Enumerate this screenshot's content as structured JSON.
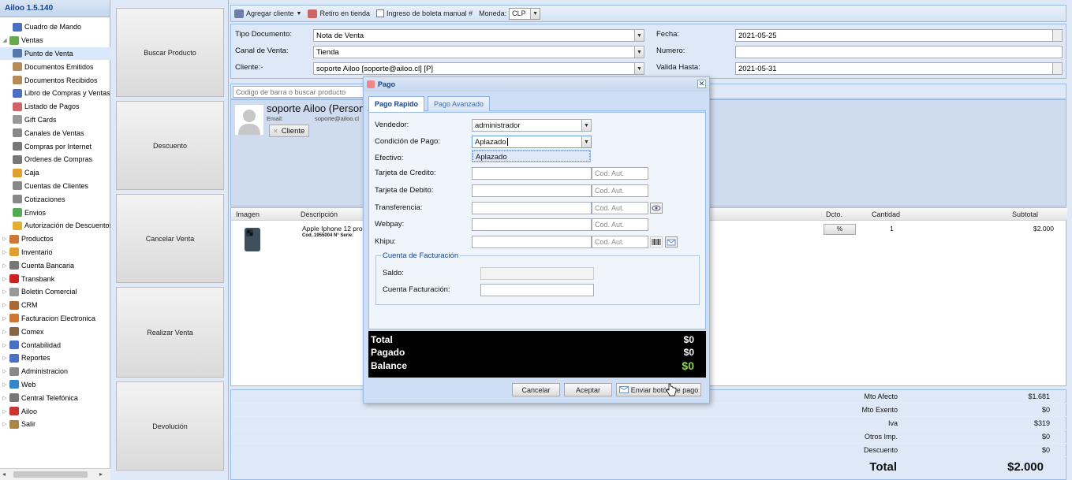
{
  "nav": {
    "header": "Ailoo 1.5.140",
    "items": [
      {
        "label": "Cuadro de Mando",
        "level": 1,
        "icon": "chart-icon",
        "color": "#4a6fc4"
      },
      {
        "label": "Ventas",
        "level": 0,
        "expanded": true,
        "icon": "gem-icon",
        "color": "#6aa84f"
      },
      {
        "label": "Punto de Venta",
        "level": 1,
        "selected": true,
        "icon": "register-icon",
        "color": "#5577aa"
      },
      {
        "label": "Documentos Emitidos",
        "level": 1,
        "icon": "document-icon",
        "color": "#b58b5a"
      },
      {
        "label": "Documentos Recibidos",
        "level": 1,
        "icon": "document-icon",
        "color": "#b58b5a"
      },
      {
        "label": "Libro de Compras y Ventas",
        "level": 1,
        "icon": "book-icon",
        "color": "#4a6fc4"
      },
      {
        "label": "Listado de Pagos",
        "level": 1,
        "icon": "list-icon",
        "color": "#cc6666"
      },
      {
        "label": "Gift Cards",
        "level": 1,
        "icon": "card-icon",
        "color": "#999999"
      },
      {
        "label": "Canales de Ventas",
        "level": 1,
        "icon": "channel-icon",
        "color": "#888888"
      },
      {
        "label": "Compras por Internet",
        "level": 1,
        "icon": "cart-icon",
        "color": "#777777"
      },
      {
        "label": "Ordenes de Compras",
        "level": 1,
        "icon": "cart-icon",
        "color": "#777777"
      },
      {
        "label": "Caja",
        "level": 1,
        "icon": "cashbox-icon",
        "color": "#e0a030"
      },
      {
        "label": "Cuentas de Clientes",
        "level": 1,
        "icon": "accounts-icon",
        "color": "#888888"
      },
      {
        "label": "Cotizaciones",
        "level": 1,
        "icon": "quote-icon",
        "color": "#888888"
      },
      {
        "label": "Envios",
        "level": 1,
        "icon": "truck-icon",
        "color": "#55aa55"
      },
      {
        "label": "Autorización de Descuentos",
        "level": 1,
        "icon": "key-icon",
        "color": "#e0b030"
      },
      {
        "label": "Productos",
        "level": 0,
        "icon": "box-icon",
        "color": "#cc7733"
      },
      {
        "label": "Inventario",
        "level": 0,
        "icon": "cube-icon",
        "color": "#e0a030"
      },
      {
        "label": "Cuenta Bancaria",
        "level": 0,
        "icon": "bank-icon",
        "color": "#777777"
      },
      {
        "label": "Transbank",
        "level": 0,
        "icon": "transbank-icon",
        "color": "#cc2222"
      },
      {
        "label": "Boletin Comercial",
        "level": 0,
        "icon": "tag-icon",
        "color": "#999999"
      },
      {
        "label": "CRM",
        "level": 0,
        "icon": "users-icon",
        "color": "#aa6633"
      },
      {
        "label": "Facturacion Electronica",
        "level": 0,
        "icon": "invoice-icon",
        "color": "#cc7733"
      },
      {
        "label": "Comex",
        "level": 0,
        "icon": "ship-icon",
        "color": "#886644"
      },
      {
        "label": "Contabilidad",
        "level": 0,
        "icon": "ledger-icon",
        "color": "#4a6fc4"
      },
      {
        "label": "Reportes",
        "level": 0,
        "icon": "chart-icon",
        "color": "#4a6fc4"
      },
      {
        "label": "Administracion",
        "level": 0,
        "icon": "gear-icon",
        "color": "#888888"
      },
      {
        "label": "Web",
        "level": 0,
        "icon": "globe-icon",
        "color": "#3388cc"
      },
      {
        "label": "Central Telefónica",
        "level": 0,
        "icon": "phone-icon",
        "color": "#777777"
      },
      {
        "label": "Ailoo",
        "level": 0,
        "icon": "ailoo-icon",
        "color": "#cc3333"
      },
      {
        "label": "Salir",
        "level": 0,
        "icon": "exit-icon",
        "color": "#aa8844"
      }
    ]
  },
  "actions": {
    "buscar": "Buscar Producto",
    "descuento": "Descuento",
    "cancelar": "Cancelar Venta",
    "realizar": "Realizar Venta",
    "devolucion": "Devolución"
  },
  "toolbar": {
    "agregar_cliente": "Agregar cliente",
    "retiro": "Retiro en tienda",
    "boleta_manual": "Ingreso de boleta manual #",
    "moneda_label": "Moneda:",
    "moneda_value": "CLP"
  },
  "docform": {
    "tipo_label": "Tipo Documento:",
    "tipo_value": "Nota de Venta",
    "canal_label": "Canal de Venta:",
    "canal_value": "Tienda",
    "cliente_label": "Cliente:-",
    "cliente_value": "soporte Ailoo [soporte@ailoo.cl] [P]",
    "fecha_label": "Fecha:",
    "fecha_value": "2021-05-25",
    "numero_label": "Numero:",
    "numero_value": "",
    "valida_label": "Valida Hasta:",
    "valida_value": "2021-05-31"
  },
  "search": {
    "placeholder": "Codigo de barra o buscar producto"
  },
  "customer": {
    "name": "soporte Ailoo (Person",
    "email_label": "Email:",
    "email_value": "soporte@ailoo.cl",
    "cliente_button": "Cliente"
  },
  "grid": {
    "headers": {
      "imagen": "Imagen",
      "descripcion": "Descripción",
      "dcto": "Dcto.",
      "cantidad": "Cantidad",
      "subtotal": "Subtotal"
    },
    "rows": [
      {
        "descripcion": "Apple Iphone 12 pro",
        "codigo": "Cod. 1955004 N° Serie:",
        "dcto": "%",
        "cantidad": "1",
        "subtotal": "$2.000"
      }
    ]
  },
  "totals": {
    "mto_afecto_label": "Mto Afecto",
    "mto_afecto": "$1.681",
    "mto_exento_label": "Mto Exento",
    "mto_exento": "$0",
    "iva_label": "Iva",
    "iva": "$319",
    "otros_label": "Otros Imp.",
    "otros": "$0",
    "descuento_label": "Descuento",
    "descuento": "$0",
    "total_label": "Total",
    "total": "$2.000"
  },
  "dialog": {
    "title": "Pago",
    "tabs": [
      "Pago Rapido",
      "Pago Avanzado"
    ],
    "vendedor_label": "Vendedor:",
    "vendedor_value": "administrador",
    "condicion_label": "Condición de Pago:",
    "condicion_value": "Aplazado",
    "dropdown_option": "Aplazado",
    "efectivo_label": "Efectivo:",
    "tarjeta_credito_label": "Tarjeta de Credito:",
    "tarjeta_debito_label": "Tarjeta de Debito:",
    "transferencia_label": "Transferencia:",
    "webpay_label": "Webpay:",
    "khipu_label": "Khipu:",
    "cod_aut_placeholder": "Cod. Aut.",
    "facturacion_legend": "Cuenta de Facturación",
    "saldo_label": "Saldo:",
    "cuenta_fact_label": "Cuenta Facturación:",
    "summary": {
      "total_label": "Total",
      "total": "$0",
      "pagado_label": "Pagado",
      "pagado": "$0",
      "balance_label": "Balance",
      "balance": "$0",
      "balance_color": "#8fd14f"
    },
    "buttons": {
      "cancelar": "Cancelar",
      "aceptar": "Aceptar",
      "enviar": "Enviar botón de pago"
    }
  }
}
